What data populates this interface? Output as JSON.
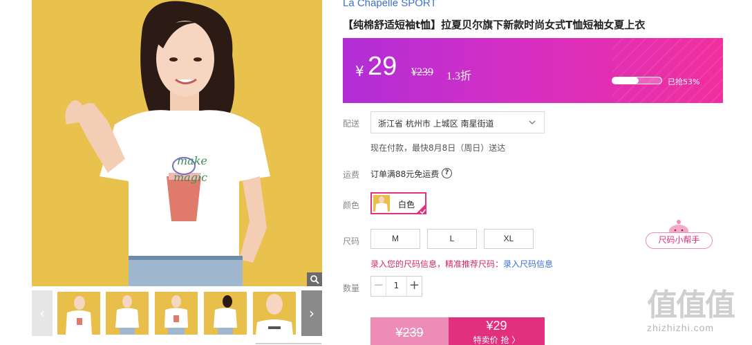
{
  "product": {
    "brand": "La Chapelle SPORT",
    "title": "【纯棉舒适短袖t恤】拉夏贝尔旗下新款时尚女式T恤短袖女夏上衣"
  },
  "gallery": {
    "thumbnail_count": 5,
    "prev_arrow": "‹",
    "next_arrow": "›"
  },
  "price": {
    "currency": "¥",
    "current": "29",
    "original": "¥239",
    "discount": "1.3折",
    "sold_percent": 53,
    "sold_text": "已抢53%"
  },
  "delivery": {
    "label": "配送",
    "address": "浙江省 杭州市 上城区 南星街道",
    "note": "现在付款，最快8月8日（周日）送达"
  },
  "shipping": {
    "label": "运费",
    "text": "订单满88元免运费",
    "help_icon": "?"
  },
  "color": {
    "label": "颜色",
    "options": [
      {
        "name": "白色",
        "selected": true
      }
    ]
  },
  "size": {
    "label": "尺码",
    "options": [
      "M",
      "L",
      "XL"
    ],
    "helper": "尺码小帮手",
    "tip_prefix": "录入您的尺码信息，精准推荐尺码：",
    "tip_link": "录入尺码信息"
  },
  "quantity": {
    "label": "数量",
    "value": "1",
    "minus": "−",
    "plus": "+"
  },
  "buy": {
    "original_price": "¥239",
    "special_price": "¥29",
    "special_action": "特卖价 抢 〉"
  },
  "watermark": {
    "logo": "值值值",
    "url": "zhizhizhi.com"
  },
  "colors": {
    "banner_start": "#b02ed6",
    "banner_end": "#f12f9d",
    "accent": "#e3307e",
    "link": "#3a6fd8",
    "photo_bg": "#e9c24d"
  }
}
